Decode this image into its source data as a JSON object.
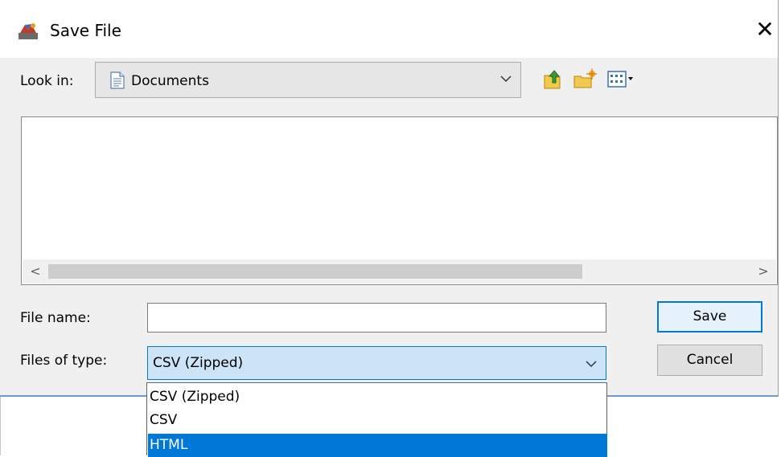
{
  "window": {
    "title": "Save File",
    "close_glyph": "✕"
  },
  "look_in": {
    "label": "Look in:",
    "value": "Documents",
    "icon": "document-icon"
  },
  "toolbar": {
    "icons": [
      "up-folder-icon",
      "new-folder-icon",
      "view-menu-icon"
    ]
  },
  "file_list": {
    "items": [],
    "scroll_left": "<",
    "scroll_right": ">",
    "horizontal_scroll_fraction": 0.71
  },
  "file_name": {
    "label": "File name:",
    "value": ""
  },
  "file_type": {
    "label": "Files of type:",
    "value": "CSV (Zipped)",
    "options": [
      "CSV (Zipped)",
      "CSV",
      "HTML"
    ],
    "highlighted": "HTML"
  },
  "buttons": {
    "save": "Save",
    "cancel": "Cancel"
  },
  "colors": {
    "accent": "#0078d7",
    "selection": "#0078d7",
    "combo_focus": "#cce4f7"
  }
}
